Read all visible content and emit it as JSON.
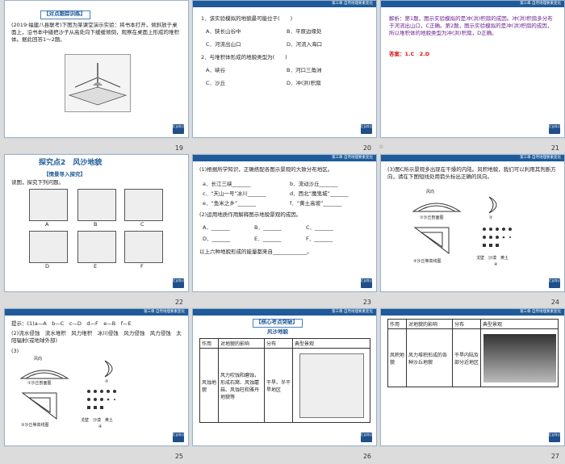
{
  "header": "第三章 自然地理要素变化",
  "nav_label": "栏目导引",
  "slides": [
    {
      "num": "19",
      "title": "【对点跟踪训练】",
      "body": "(2019·福建八县联考)下图为某课堂演示实验：将书本打开，倾斜放于桌面上，沿书本中缝把沙子从高处向下缓缓倾倒，观察在桌面上形成的堆积体。据此回答1～2题。"
    },
    {
      "num": "20",
      "q1": "1．该实验模拟的地貌最可能位于(　　)",
      "q1a": "A．狭长山谷中",
      "q1b": "B．平原边缘处",
      "q1c": "C．河流出山口",
      "q1d": "D．河流入海口",
      "q2": "2．与堆积体形成的地貌类型为(　　)",
      "q2a": "A．峡谷",
      "q2b": "B．河口三角洲",
      "q2c": "C．沙丘",
      "q2d": "D．冲(洪)积扇"
    },
    {
      "num": "21",
      "explain": "解析：第1题，图示实验模拟的是冲(洪)积扇的成因。冲(洪)积扇多分布于河流出山口，C正确。第2题，图示实验模拟的是冲(洪)积扇的成因，所以堆积体的地貌类型为冲(洪)积扇，D正确。",
      "answer": "答案：1.C　2.D"
    },
    {
      "num": "22",
      "title": "探究点2　风沙地貌",
      "sub": "【情景导入探究】",
      "body": "读图，探究下列问题。",
      "labels": [
        "A",
        "B",
        "C",
        "D",
        "E",
        "F"
      ]
    },
    {
      "num": "23",
      "l1": "(1)根据所学知识，正确搭配各图示景观的大致分布地区。",
      "a": "a．长江三峡_______",
      "b": "b．流动沙丘_______",
      "c": "c．“天山一号”冰川_______",
      "d": "d．西北“魔鬼城”_______",
      "e": "e．“鱼米之乡”_______",
      "f": "f．“黄土高坡”_______",
      "l2": "(2)运用地质作用解释图示地貌景观的成因。",
      "A": "A．_______",
      "B": "B．_______",
      "C": "C．_______",
      "D": "D．_______",
      "E": "E．_______",
      "F": "F．_______",
      "l3": "以上六种地貌形成的能量都来自_____________。"
    },
    {
      "num": "24",
      "body": "(3)图C所示景观多出现在干燥的内陆。风积地貌，我们可以利用其判断方向，请在下图短线处用箭头标出正确的风向。",
      "wind": "风向",
      "cap1": "①沙丘剖面图",
      "cap2": "②",
      "cap3": "③沙丘等高线图",
      "cap4": "④",
      "legend": "戈壁　沙漠　黄土"
    },
    {
      "num": "25",
      "hint": "提示：(1)a—A　b—C　c—D　d—F　e—B　f—E",
      "l2": "(2)流水侵蚀　流水堆积　风力堆积　冰川侵蚀　风力侵蚀　风力侵蚀　太阳辐射(或地球外部)",
      "l3": "(3)",
      "wind": "风向",
      "cap1": "①沙丘剖面图",
      "cap2": "②",
      "cap3": "③沙丘等高线图",
      "cap4": "④",
      "legend": "戈壁　沙漠　黄土"
    },
    {
      "num": "26",
      "title": "【核心考点突破】",
      "sub": "风沙地貌",
      "h1": "作用",
      "h2": "对地貌的影响",
      "h3": "分布",
      "h4": "典型景观",
      "c1": "风蚀地貌",
      "c2": "风力吹蚀和磨蚀，形成石窝、风蚀蘑菇、风蚀柱和雅丹地貌等",
      "c3": "干旱、半干旱地区"
    },
    {
      "num": "27",
      "h1": "作用",
      "h2": "对地貌的影响",
      "h3": "分布",
      "h4": "典型景观",
      "c1": "风积地貌",
      "c2": "风力堆积形成的各种沙丘地貌",
      "c3": "干旱内陆及部分近地区"
    }
  ]
}
